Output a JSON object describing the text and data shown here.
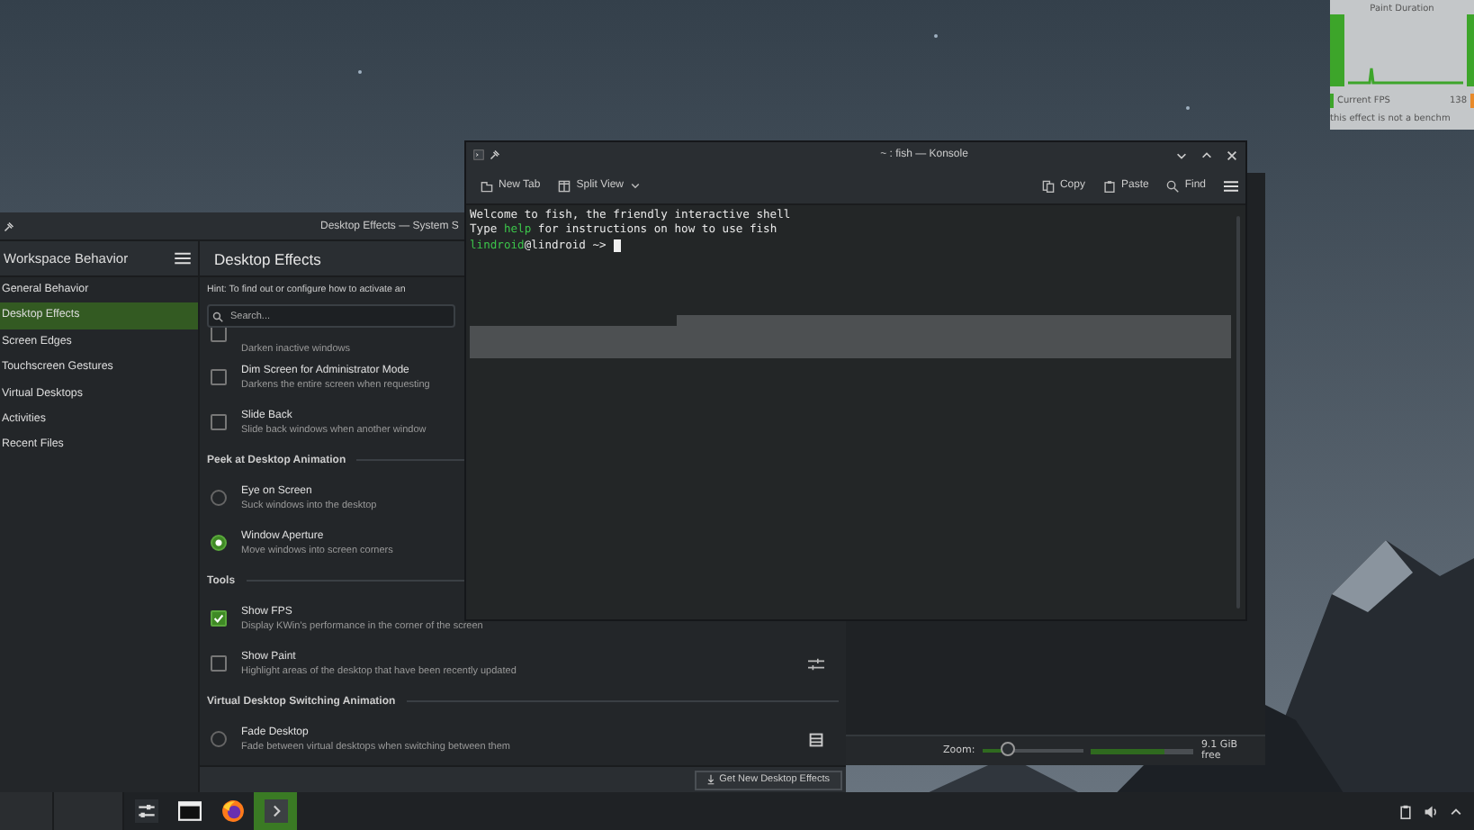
{
  "fps_overlay": {
    "title": "Paint Duration",
    "fps_label": "Current FPS",
    "fps_value": "138",
    "note": "this effect is not a benchm"
  },
  "file_manager": {
    "zoom_label": "Zoom:",
    "zoom": {
      "level": 0.25
    },
    "free_space": {
      "level": 0.72
    },
    "free_label": "9.1 GiB free"
  },
  "settings": {
    "title": "Desktop Effects — System S",
    "sidebar": {
      "title": "Workspace Behavior",
      "items": [
        {
          "label": "General Behavior",
          "selected": false
        },
        {
          "label": "Desktop Effects",
          "selected": true
        },
        {
          "label": "Screen Edges",
          "selected": false
        },
        {
          "label": "Touchscreen Gestures",
          "selected": false
        },
        {
          "label": "Virtual Desktops",
          "selected": false
        },
        {
          "label": "Activities",
          "selected": false
        },
        {
          "label": "Recent Files",
          "selected": false
        }
      ]
    },
    "page_title": "Desktop Effects",
    "hint": "Hint: To find out or configure how to activate an",
    "search": {
      "placeholder": "Search..."
    },
    "effects": [
      {
        "kind": "checkbox",
        "description": "Darken inactive windows",
        "checked": false,
        "partial": true
      },
      {
        "kind": "checkbox",
        "title": "Dim Screen for Administrator Mode",
        "description": "Darkens the entire screen when requesting",
        "checked": false
      },
      {
        "kind": "checkbox",
        "title": "Slide Back",
        "description": "Slide back windows when another window",
        "checked": false
      },
      {
        "kind": "section",
        "title": "Peek at Desktop Animation"
      },
      {
        "kind": "radio",
        "title": "Eye on Screen",
        "description": "Suck windows into the desktop",
        "selected": false
      },
      {
        "kind": "radio",
        "title": "Window Aperture",
        "description": "Move windows into screen corners",
        "selected": true
      },
      {
        "kind": "section",
        "title": "Tools"
      },
      {
        "kind": "checkbox",
        "title": "Show FPS",
        "description": "Display KWin's performance in the corner of the screen",
        "checked": true
      },
      {
        "kind": "checkbox",
        "title": "Show Paint",
        "description": "Highlight areas of the desktop that have been recently updated",
        "checked": false,
        "action": {
          "kind": "configure"
        }
      },
      {
        "kind": "section",
        "title": "Virtual Desktop Switching Animation"
      },
      {
        "kind": "radio",
        "title": "Fade Desktop",
        "description": "Fade between virtual desktops when switching between them",
        "selected": false,
        "action": {
          "kind": "video"
        }
      }
    ],
    "footer_button": "Get New Desktop Effects"
  },
  "konsole": {
    "title": "~ : fish — Konsole",
    "toolbar": [
      {
        "kind": "new-tab",
        "label": "New Tab"
      },
      {
        "kind": "split",
        "label": "Split View"
      },
      {
        "kind": "copy",
        "label": "Copy"
      },
      {
        "kind": "paste",
        "label": "Paste"
      },
      {
        "kind": "find",
        "label": "Find"
      }
    ],
    "lines": [
      {
        "segments": [
          {
            "kind": "plain",
            "text": "Welcome to fish, the friendly interactive shell"
          }
        ]
      },
      {
        "segments": [
          {
            "kind": "plain",
            "text": "Type "
          },
          {
            "kind": "accent",
            "text": "help"
          },
          {
            "kind": "plain",
            "text": " for instructions on how to use fish"
          }
        ]
      },
      {
        "segments": [
          {
            "kind": "accent",
            "text": "lindroid"
          },
          {
            "kind": "plain",
            "text": "@lindroid ~> "
          }
        ],
        "cursor": true
      }
    ]
  },
  "taskbar": {
    "apps": [
      {
        "kind": "settings",
        "active": false
      },
      {
        "kind": "terminal",
        "active": false
      },
      {
        "kind": "browser",
        "active": false
      },
      {
        "kind": "konsole",
        "active": true
      }
    ]
  }
}
